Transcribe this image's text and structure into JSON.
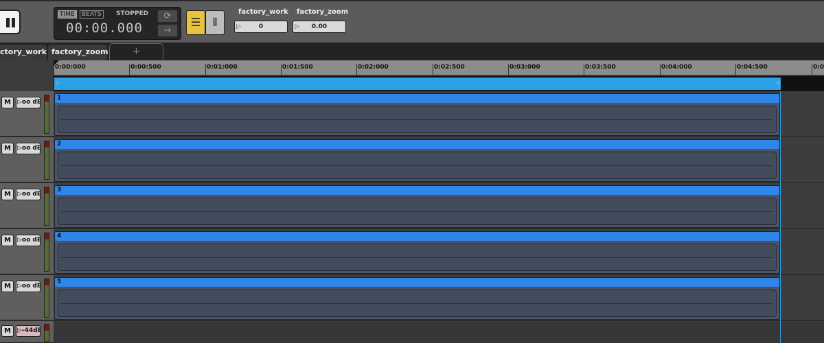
{
  "transport": {
    "mode_time": "TIME",
    "mode_beats": "BEATS",
    "state": "STOPPED",
    "time": "00:00.000",
    "loop_icon": "⟳",
    "next_icon": "→"
  },
  "view": {
    "list_icon": "☰",
    "grid_icon": "⦀"
  },
  "markers": [
    {
      "label": "factory_work",
      "value": "0"
    },
    {
      "label": "factory_zoom",
      "value": "0.00"
    }
  ],
  "tabs": {
    "work": "ctory_work",
    "zoom": "factory_zoom",
    "add": "+"
  },
  "ruler": [
    "0:00:000",
    "0:00:500",
    "0:01:000",
    "0:01:500",
    "0:02:000",
    "0:02:500",
    "0:03:000",
    "0:03:500",
    "0:04:000",
    "0:04:500",
    "0:0"
  ],
  "tracks": [
    {
      "mute": "M",
      "gain": "▷oo dB",
      "region": "1"
    },
    {
      "mute": "M",
      "gain": "▷oo dB",
      "region": "2"
    },
    {
      "mute": "M",
      "gain": "▷oo dB",
      "region": "3"
    },
    {
      "mute": "M",
      "gain": "▷oo dB",
      "region": "4"
    },
    {
      "mute": "M",
      "gain": "▷oo dB",
      "region": "5"
    },
    {
      "mute": "M",
      "gain": "▷-44dB",
      "region": ""
    }
  ],
  "colors": {
    "accent": "#2ea0e6",
    "region_header": "#2f86e8",
    "view_active": "#e9c33f"
  }
}
